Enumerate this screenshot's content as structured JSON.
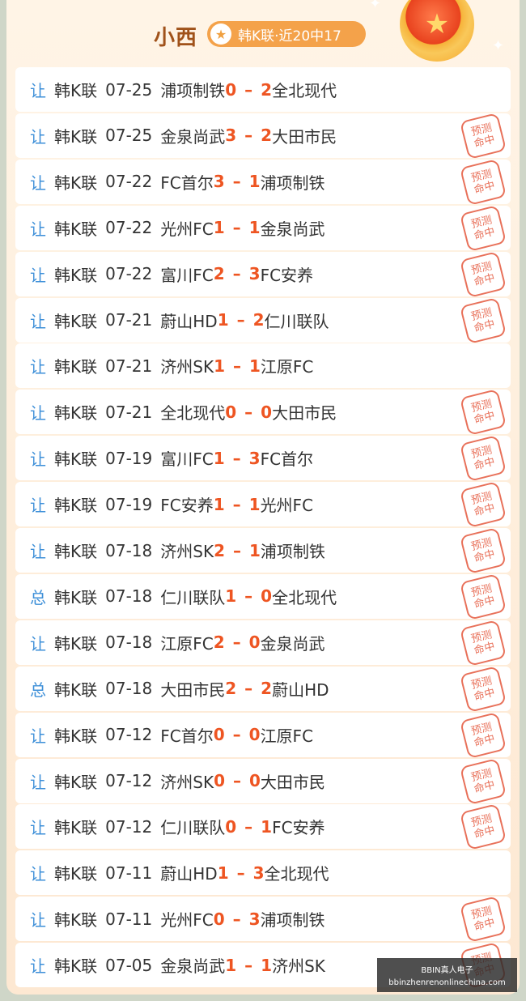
{
  "header": {
    "title": "小西",
    "badge_text": "韩K联·近20中17"
  },
  "stamp": {
    "line1": "预测",
    "line2": "命中"
  },
  "watermark": {
    "line1": "BBIN真人电子",
    "line2": "bbinzhenrenonlinechina.com"
  },
  "matches": [
    {
      "tag": "让",
      "league": "韩K联",
      "date": "07-25",
      "home": "浦项制铁",
      "hs": "0",
      "as": "2",
      "away": "全北现代",
      "hit": false
    },
    {
      "tag": "让",
      "league": "韩K联",
      "date": "07-25",
      "home": "金泉尚武",
      "hs": "3",
      "as": "2",
      "away": "大田市民",
      "hit": true
    },
    {
      "tag": "让",
      "league": "韩K联",
      "date": "07-22",
      "home": "FC首尔",
      "hs": "3",
      "as": "1",
      "away": "浦项制铁",
      "hit": true
    },
    {
      "tag": "让",
      "league": "韩K联",
      "date": "07-22",
      "home": "光州FC",
      "hs": "1",
      "as": "1",
      "away": "金泉尚武",
      "hit": true
    },
    {
      "tag": "让",
      "league": "韩K联",
      "date": "07-22",
      "home": "富川FC",
      "hs": "2",
      "as": "3",
      "away": "FC安养",
      "hit": true
    },
    {
      "tag": "让",
      "league": "韩K联",
      "date": "07-21",
      "home": "蔚山HD",
      "hs": "1",
      "as": "2",
      "away": "仁川联队",
      "hit": true
    },
    {
      "tag": "让",
      "league": "韩K联",
      "date": "07-21",
      "home": "济州SK",
      "hs": "1",
      "as": "1",
      "away": "江原FC",
      "hit": false
    },
    {
      "tag": "让",
      "league": "韩K联",
      "date": "07-21",
      "home": "全北现代",
      "hs": "0",
      "as": "0",
      "away": "大田市民",
      "hit": true
    },
    {
      "tag": "让",
      "league": "韩K联",
      "date": "07-19",
      "home": "富川FC",
      "hs": "1",
      "as": "3",
      "away": "FC首尔",
      "hit": true
    },
    {
      "tag": "让",
      "league": "韩K联",
      "date": "07-19",
      "home": "FC安养",
      "hs": "1",
      "as": "1",
      "away": "光州FC",
      "hit": true
    },
    {
      "tag": "让",
      "league": "韩K联",
      "date": "07-18",
      "home": "济州SK",
      "hs": "2",
      "as": "1",
      "away": "浦项制铁",
      "hit": true
    },
    {
      "tag": "总",
      "league": "韩K联",
      "date": "07-18",
      "home": "仁川联队",
      "hs": "1",
      "as": "0",
      "away": "全北现代",
      "hit": true
    },
    {
      "tag": "让",
      "league": "韩K联",
      "date": "07-18",
      "home": "江原FC",
      "hs": "2",
      "as": "0",
      "away": "金泉尚武",
      "hit": true
    },
    {
      "tag": "总",
      "league": "韩K联",
      "date": "07-18",
      "home": "大田市民",
      "hs": "2",
      "as": "2",
      "away": "蔚山HD",
      "hit": true
    },
    {
      "tag": "让",
      "league": "韩K联",
      "date": "07-12",
      "home": "FC首尔",
      "hs": "0",
      "as": "0",
      "away": "江原FC",
      "hit": true
    },
    {
      "tag": "让",
      "league": "韩K联",
      "date": "07-12",
      "home": "济州SK",
      "hs": "0",
      "as": "0",
      "away": "大田市民",
      "hit": true
    },
    {
      "tag": "让",
      "league": "韩K联",
      "date": "07-12",
      "home": "仁川联队",
      "hs": "0",
      "as": "1",
      "away": "FC安养",
      "hit": true
    },
    {
      "tag": "让",
      "league": "韩K联",
      "date": "07-11",
      "home": "蔚山HD",
      "hs": "1",
      "as": "3",
      "away": "全北现代",
      "hit": false
    },
    {
      "tag": "让",
      "league": "韩K联",
      "date": "07-11",
      "home": "光州FC",
      "hs": "0",
      "as": "3",
      "away": "浦项制铁",
      "hit": true
    },
    {
      "tag": "让",
      "league": "韩K联",
      "date": "07-05",
      "home": "金泉尚武",
      "hs": "1",
      "as": "1",
      "away": "济州SK",
      "hit": true
    }
  ]
}
